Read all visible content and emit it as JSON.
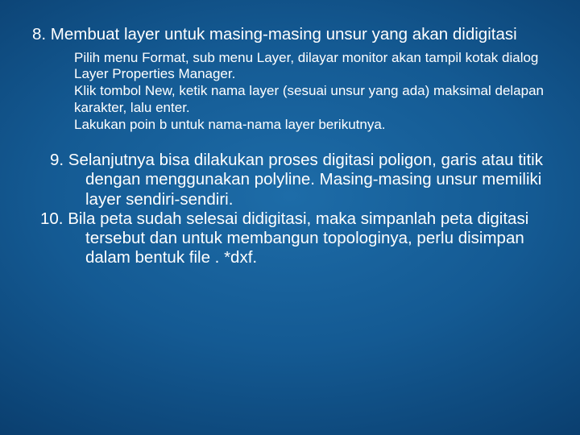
{
  "item8": {
    "title": "8. Membuat layer untuk masing-masing unsur yang akan didigitasi",
    "sub": [
      "Pilih menu Format, sub menu Layer, dilayar monitor akan tampil kotak dialog Layer Properties Manager.",
      "Klik tombol New, ketik nama layer (sesuai unsur yang ada) maksimal delapan karakter, lalu enter.",
      "Lakukan poin b untuk nama-nama layer berikutnya."
    ]
  },
  "item9": "9. Selanjutnya bisa dilakukan proses digitasi poligon, garis atau titik dengan menggunakan polyline. Masing-masing unsur memiliki layer sendiri-sendiri.",
  "item10": "10. Bila peta sudah selesai didigitasi, maka simpanlah peta digitasi tersebut dan untuk membangun topologinya, perlu disimpan dalam bentuk file . *dxf."
}
